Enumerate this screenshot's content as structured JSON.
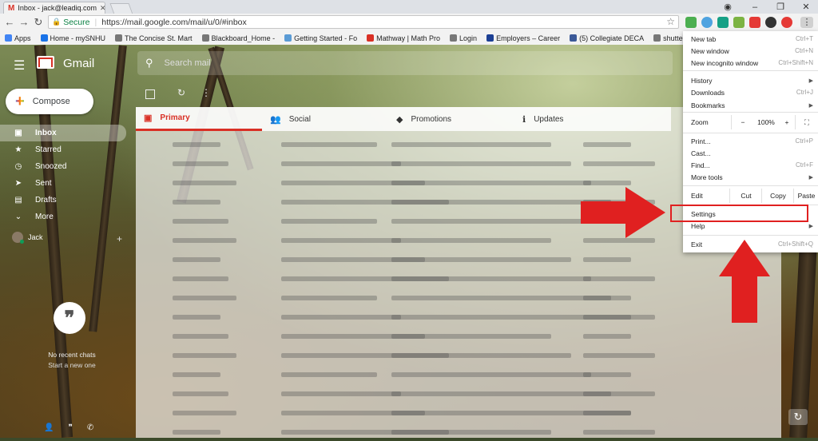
{
  "browser": {
    "tab_title": "Inbox - jack@leadiq.com",
    "secure_label": "Secure",
    "url": "https://mail.google.com/mail/u/0/#inbox",
    "window_controls": [
      "–",
      "❐",
      "✕"
    ]
  },
  "bookmarks": [
    {
      "label": "Apps",
      "color": "#4285f4"
    },
    {
      "label": "Home - mySNHU",
      "color": "#1a73e8"
    },
    {
      "label": "The Concise St. Mart",
      "color": "#777777"
    },
    {
      "label": "Blackboard_Home -",
      "color": "#777777"
    },
    {
      "label": "Getting Started - Fo",
      "color": "#5a9bd5"
    },
    {
      "label": "Mathway | Math Pro",
      "color": "#d93025"
    },
    {
      "label": "Login",
      "color": "#777777"
    },
    {
      "label": "Employers – Career",
      "color": "#1c3f94"
    },
    {
      "label": "(5) Collegiate DECA",
      "color": "#3b5998"
    },
    {
      "label": "shutterstock",
      "color": "#777777"
    }
  ],
  "gmail": {
    "logo_text": "Gmail",
    "search_placeholder": "Search mail",
    "compose_label": "Compose",
    "nav": [
      {
        "label": "Inbox",
        "icon": "inbox-icon",
        "glyph": "▣",
        "active": true
      },
      {
        "label": "Starred",
        "icon": "star-icon",
        "glyph": "★",
        "active": false
      },
      {
        "label": "Snoozed",
        "icon": "clock-icon",
        "glyph": "◷",
        "active": false
      },
      {
        "label": "Sent",
        "icon": "send-icon",
        "glyph": "➤",
        "active": false
      },
      {
        "label": "Drafts",
        "icon": "draft-icon",
        "glyph": "▤",
        "active": false
      },
      {
        "label": "More",
        "icon": "chevron-down-icon",
        "glyph": "⌄",
        "active": false
      }
    ],
    "user_name": "Jack",
    "chat_empty": "No recent chats",
    "chat_start": "Start a new one",
    "categories": [
      {
        "label": "Primary",
        "glyph": "▣",
        "icon": "primary-icon",
        "active": true
      },
      {
        "label": "Social",
        "glyph": "👥",
        "icon": "social-icon",
        "active": false
      },
      {
        "label": "Promotions",
        "glyph": "◆",
        "icon": "tag-icon",
        "active": false
      },
      {
        "label": "Updates",
        "glyph": "ℹ",
        "icon": "info-icon",
        "active": false
      }
    ]
  },
  "chrome_menu": {
    "new_tab": "New tab",
    "new_tab_key": "Ctrl+T",
    "new_window": "New window",
    "new_window_key": "Ctrl+N",
    "incognito": "New incognito window",
    "incognito_key": "Ctrl+Shift+N",
    "history": "History",
    "downloads": "Downloads",
    "downloads_key": "Ctrl+J",
    "bookmarks": "Bookmarks",
    "zoom": "Zoom",
    "zoom_minus": "−",
    "zoom_value": "100%",
    "zoom_plus": "+",
    "print": "Print...",
    "print_key": "Ctrl+P",
    "cast": "Cast...",
    "find": "Find...",
    "find_key": "Ctrl+F",
    "more_tools": "More tools",
    "edit": "Edit",
    "cut": "Cut",
    "copy": "Copy",
    "paste": "Paste",
    "settings": "Settings",
    "help": "Help",
    "exit": "Exit",
    "exit_key": "Ctrl+Shift+Q"
  },
  "colors": {
    "annotation": "#e02020",
    "gmail_red": "#d93025"
  }
}
